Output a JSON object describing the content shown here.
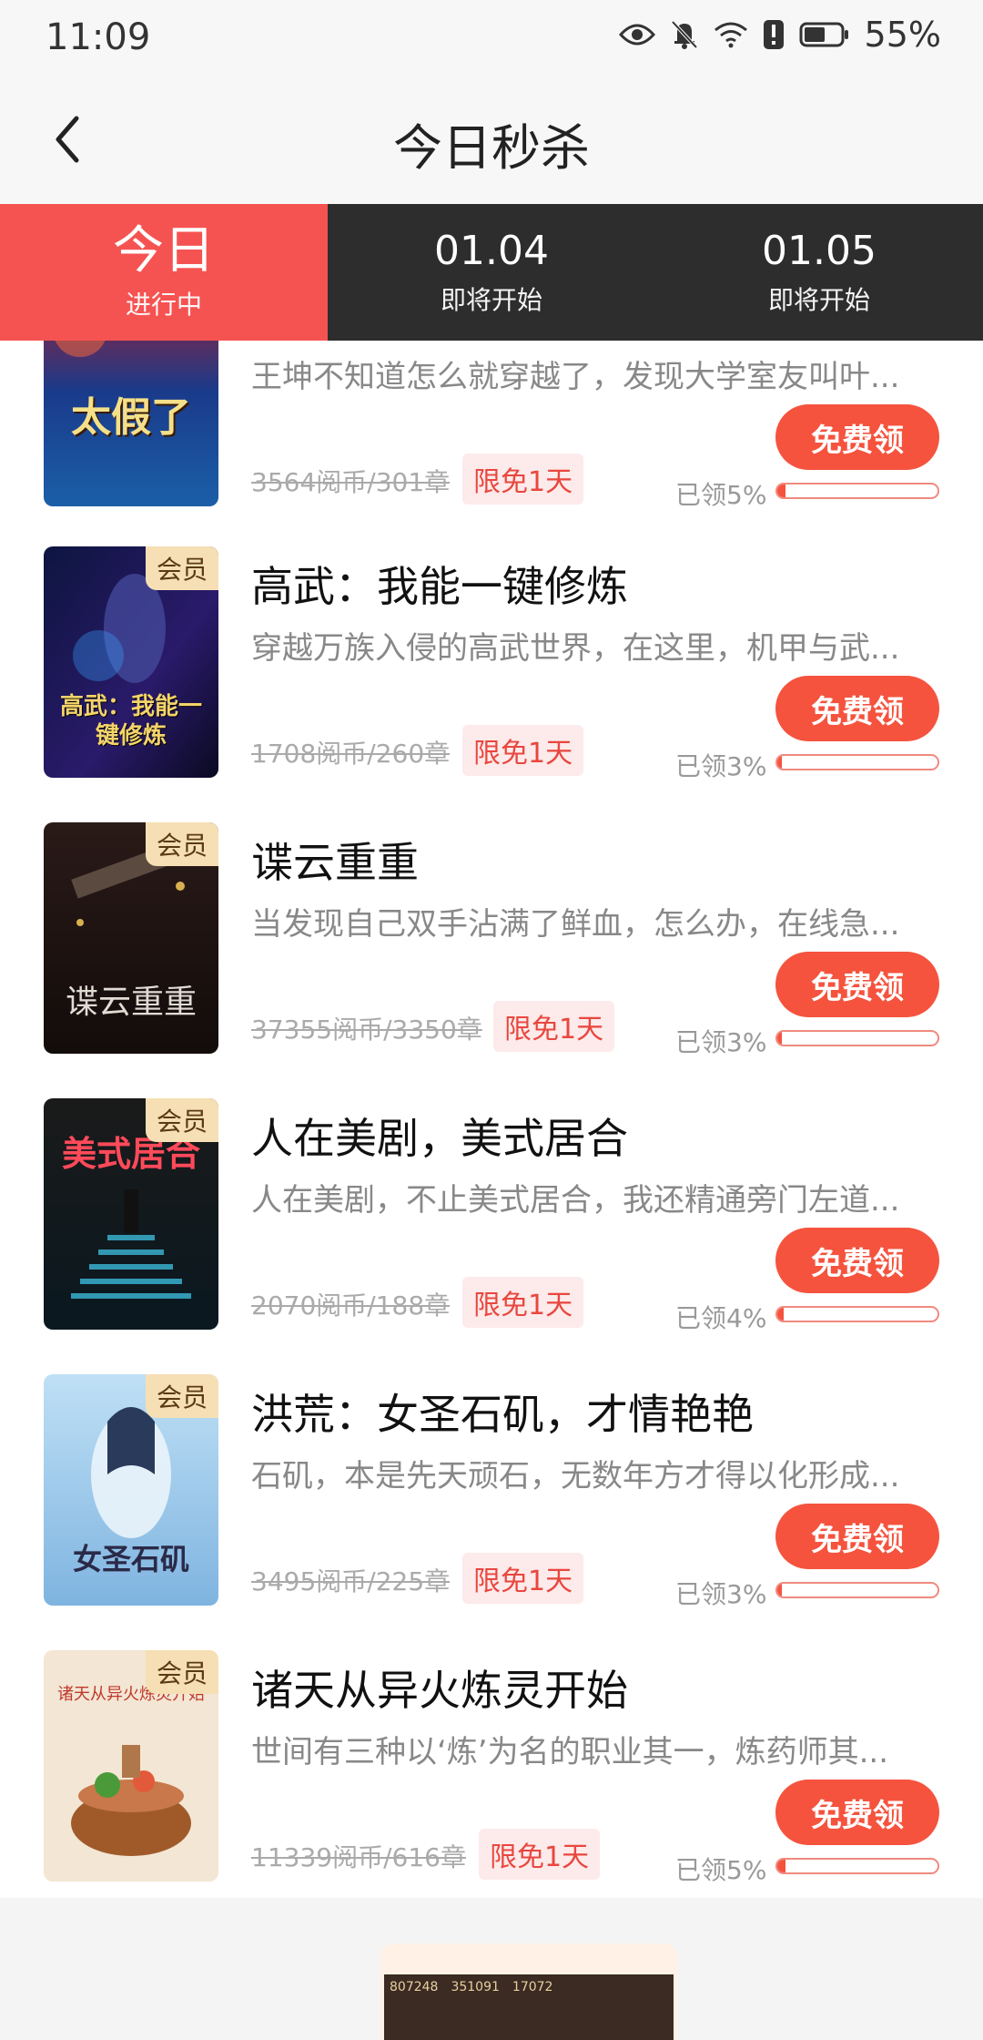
{
  "status": {
    "time": "11:09",
    "battery": "55%",
    "icons": [
      "eye-icon",
      "bell-mute-icon",
      "wifi-icon",
      "alert-icon",
      "battery-icon"
    ]
  },
  "header": {
    "title": "今日秒杀",
    "back_icon": "chevron-left-icon"
  },
  "tabs": [
    {
      "label": "今日",
      "sub": "进行中"
    },
    {
      "label": "01.04",
      "sub": "即将开始"
    },
    {
      "label": "01.05",
      "sub": "即将开始"
    }
  ],
  "colors": {
    "accent": "#f55352",
    "claim_button": "#f5533e",
    "dark_tabbar": "#2d2d2d",
    "vip_badge_bg": "#f6dfb4"
  },
  "books": [
    {
      "title": "",
      "desc": "王坤不知道怎么就穿越了，发现大学室友叫叶...",
      "price": "3564阅币/301章",
      "badge": "限免1天",
      "claim": "免费领",
      "pct_label": "已领5%",
      "pct": 0.05,
      "vip": "",
      "cover_text": "太假了"
    },
    {
      "title": "高武：我能一键修炼",
      "desc": "穿越万族入侵的高武世界，在这里，机甲与武...",
      "price": "1708阅币/260章",
      "badge": "限免1天",
      "claim": "免费领",
      "pct_label": "已领3%",
      "pct": 0.03,
      "vip": "会员",
      "cover_text": "高武：我能一键修炼"
    },
    {
      "title": "谍云重重",
      "desc": "当发现自己双手沾满了鲜血，怎么办，在线急...",
      "price": "37355阅币/3350章",
      "badge": "限免1天",
      "claim": "免费领",
      "pct_label": "已领3%",
      "pct": 0.03,
      "vip": "会员",
      "cover_text": "谍云重重"
    },
    {
      "title": "人在美剧，美式居合",
      "desc": "人在美剧，不止美式居合，我还精通旁门左道...",
      "price": "2070阅币/188章",
      "badge": "限免1天",
      "claim": "免费领",
      "pct_label": "已领4%",
      "pct": 0.04,
      "vip": "会员",
      "cover_text": "美式居合"
    },
    {
      "title": "洪荒：女圣石矶，才情艳艳",
      "desc": "石矶，本是先天顽石，无数年方才得以化形成...",
      "price": "3495阅币/225章",
      "badge": "限免1天",
      "claim": "免费领",
      "pct_label": "已领3%",
      "pct": 0.03,
      "vip": "会员",
      "cover_text": "女圣石矶"
    },
    {
      "title": "诸天从异火炼灵开始",
      "desc": "世间有三种以‘炼’为名的职业其一，炼药师其...",
      "price": "11339阅币/616章",
      "badge": "限免1天",
      "claim": "免费领",
      "pct_label": "已领5%",
      "pct": 0.05,
      "vip": "会员",
      "cover_text": "诸天从异火炼灵开始"
    }
  ],
  "banner": {
    "stats": [
      "807248",
      "351091",
      "17072"
    ]
  }
}
